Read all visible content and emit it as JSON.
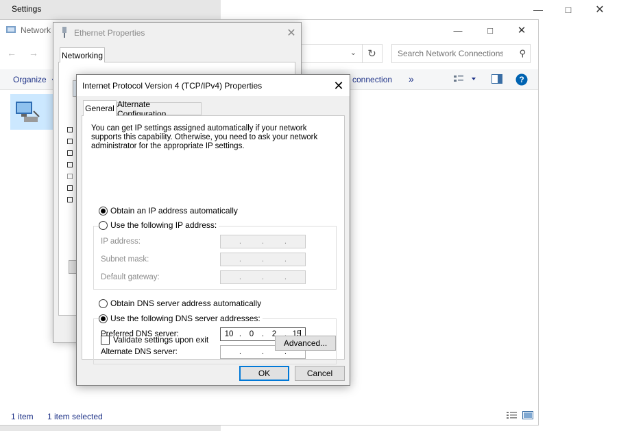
{
  "settings": {
    "title": "Settings"
  },
  "explorer": {
    "title": "Network",
    "search_placeholder": "Search Network Connections",
    "organize_label": "Organize",
    "rename_fragment": "connection",
    "more_label": "»",
    "status_count": "1 item",
    "status_selected": "1 item selected",
    "colors": {
      "link": "#1e3287",
      "help": "#0063b1"
    }
  },
  "ethernet": {
    "title": "Ethernet Properties",
    "tab_networking": "Networking"
  },
  "ipv4": {
    "title": "Internet Protocol Version 4 (TCP/IPv4) Properties",
    "tabs": {
      "general": "General",
      "alternate": "Alternate Configuration"
    },
    "intro": "You can get IP settings assigned automatically if your network supports this capability. Otherwise, you need to ask your network administrator for the appropriate IP settings.",
    "ip_auto_label": "Obtain an IP address automatically",
    "ip_manual_label": "Use the following IP address:",
    "ip_address_label": "IP address:",
    "subnet_label": "Subnet mask:",
    "gateway_label": "Default gateway:",
    "dns_auto_label": "Obtain DNS server address automatically",
    "dns_manual_label": "Use the following DNS server addresses:",
    "preferred_dns_label": "Preferred DNS server:",
    "alternate_dns_label": "Alternate DNS server:",
    "preferred_dns": [
      "10",
      "0",
      "2",
      "15"
    ],
    "alternate_dns": [
      "",
      "",
      "",
      ""
    ],
    "validate_label": "Validate settings upon exit",
    "advanced_label": "Advanced...",
    "ok_label": "OK",
    "cancel_label": "Cancel",
    "ip_mode": "auto",
    "dns_mode": "manual",
    "validate_checked": false,
    "colors": {
      "default_button_border": "#0078d7"
    }
  }
}
